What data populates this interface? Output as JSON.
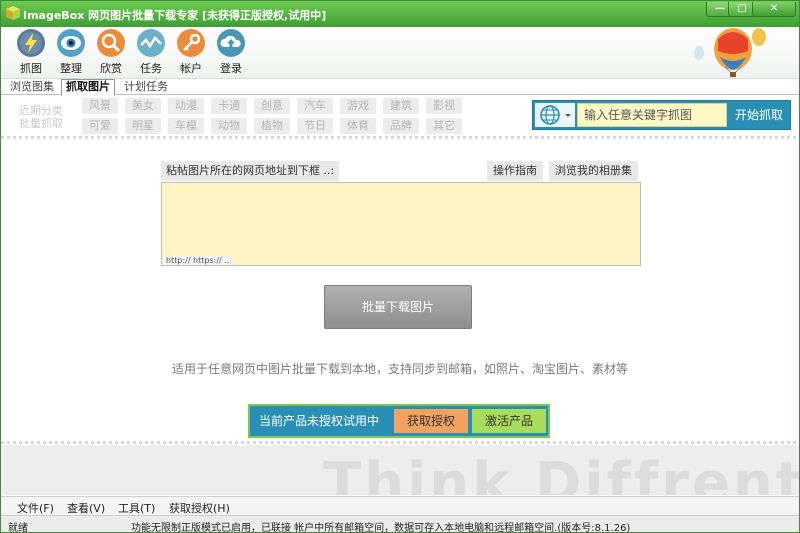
{
  "window": {
    "title": "ImageBox 网页图片批量下载专家 [未获得正版授权,试用中]",
    "minimize": "—",
    "maximize": "□",
    "close": "✕"
  },
  "toolbar": {
    "items": [
      {
        "label": "抓图",
        "icon": "lightning-icon",
        "color": "#5a7fa0"
      },
      {
        "label": "整理",
        "icon": "eye-icon",
        "color": "#5aa8c8"
      },
      {
        "label": "欣赏",
        "icon": "magnifier-icon",
        "color": "#e88a3a"
      },
      {
        "label": "任务",
        "icon": "wave-icon",
        "color": "#6fb3c9"
      },
      {
        "label": "帐户",
        "icon": "key-icon",
        "color": "#e88a3a"
      },
      {
        "label": "登录",
        "icon": "cloud-upload-icon",
        "color": "#4a9ab8"
      }
    ]
  },
  "tabs": [
    {
      "label": "浏览图集"
    },
    {
      "label": "抓取图片",
      "active": true
    },
    {
      "label": "计划任务"
    }
  ],
  "categories": {
    "recent_label_1": "近期分类",
    "recent_label_2": "批量抓取",
    "row1": [
      "风景",
      "美女",
      "动漫",
      "卡通",
      "创意",
      "汽车",
      "游戏",
      "建筑",
      "影视"
    ],
    "row2": [
      "可爱",
      "明星",
      "车模",
      "动物",
      "植物",
      "节日",
      "体育",
      "品牌",
      "其它"
    ]
  },
  "search": {
    "placeholder": "输入任意关键字抓图",
    "button": "开始抓取"
  },
  "main": {
    "url_prompt": "粘帖图片所在的网页地址到下框 ..:",
    "guide_button": "操作指南",
    "browse_button": "浏览我的相册集",
    "textarea_hint": "http:// https:// ..",
    "download_button": "批量下载图片",
    "description": "适用于任意网页中图片批量下载到本地，支持同步到邮箱，如照片、淘宝图片、素材等"
  },
  "license": {
    "text": "当前产品未授权试用中",
    "get_button": "获取授权",
    "activate_button": "激活产品"
  },
  "watermark": "Think Diffrent",
  "menubar": [
    "文件(F)",
    "查看(V)",
    "工具(T)",
    "获取授权(H)"
  ],
  "status": {
    "state": "就绪",
    "message": "功能无限制正版模式已启用，已联接 帐户中所有邮箱空间，数据可存入本地电脑和远程邮箱空间.(版本号:8.1.26)"
  },
  "colors": {
    "title_green": "#4caf3c",
    "accent_blue": "#2a8fb4",
    "get_orange": "#f3a25f",
    "activate_green": "#a9dc5a",
    "textarea_yellow": "#fff5c4"
  }
}
